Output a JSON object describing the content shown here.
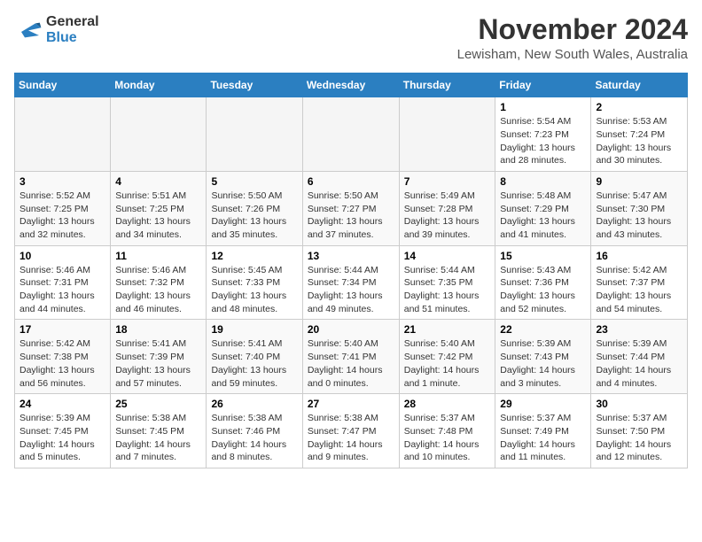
{
  "logo": {
    "line1": "General",
    "line2": "Blue"
  },
  "title": "November 2024",
  "subtitle": "Lewisham, New South Wales, Australia",
  "days_of_week": [
    "Sunday",
    "Monday",
    "Tuesday",
    "Wednesday",
    "Thursday",
    "Friday",
    "Saturday"
  ],
  "weeks": [
    [
      {
        "day": "",
        "info": ""
      },
      {
        "day": "",
        "info": ""
      },
      {
        "day": "",
        "info": ""
      },
      {
        "day": "",
        "info": ""
      },
      {
        "day": "",
        "info": ""
      },
      {
        "day": "1",
        "info": "Sunrise: 5:54 AM\nSunset: 7:23 PM\nDaylight: 13 hours\nand 28 minutes."
      },
      {
        "day": "2",
        "info": "Sunrise: 5:53 AM\nSunset: 7:24 PM\nDaylight: 13 hours\nand 30 minutes."
      }
    ],
    [
      {
        "day": "3",
        "info": "Sunrise: 5:52 AM\nSunset: 7:25 PM\nDaylight: 13 hours\nand 32 minutes."
      },
      {
        "day": "4",
        "info": "Sunrise: 5:51 AM\nSunset: 7:25 PM\nDaylight: 13 hours\nand 34 minutes."
      },
      {
        "day": "5",
        "info": "Sunrise: 5:50 AM\nSunset: 7:26 PM\nDaylight: 13 hours\nand 35 minutes."
      },
      {
        "day": "6",
        "info": "Sunrise: 5:50 AM\nSunset: 7:27 PM\nDaylight: 13 hours\nand 37 minutes."
      },
      {
        "day": "7",
        "info": "Sunrise: 5:49 AM\nSunset: 7:28 PM\nDaylight: 13 hours\nand 39 minutes."
      },
      {
        "day": "8",
        "info": "Sunrise: 5:48 AM\nSunset: 7:29 PM\nDaylight: 13 hours\nand 41 minutes."
      },
      {
        "day": "9",
        "info": "Sunrise: 5:47 AM\nSunset: 7:30 PM\nDaylight: 13 hours\nand 43 minutes."
      }
    ],
    [
      {
        "day": "10",
        "info": "Sunrise: 5:46 AM\nSunset: 7:31 PM\nDaylight: 13 hours\nand 44 minutes."
      },
      {
        "day": "11",
        "info": "Sunrise: 5:46 AM\nSunset: 7:32 PM\nDaylight: 13 hours\nand 46 minutes."
      },
      {
        "day": "12",
        "info": "Sunrise: 5:45 AM\nSunset: 7:33 PM\nDaylight: 13 hours\nand 48 minutes."
      },
      {
        "day": "13",
        "info": "Sunrise: 5:44 AM\nSunset: 7:34 PM\nDaylight: 13 hours\nand 49 minutes."
      },
      {
        "day": "14",
        "info": "Sunrise: 5:44 AM\nSunset: 7:35 PM\nDaylight: 13 hours\nand 51 minutes."
      },
      {
        "day": "15",
        "info": "Sunrise: 5:43 AM\nSunset: 7:36 PM\nDaylight: 13 hours\nand 52 minutes."
      },
      {
        "day": "16",
        "info": "Sunrise: 5:42 AM\nSunset: 7:37 PM\nDaylight: 13 hours\nand 54 minutes."
      }
    ],
    [
      {
        "day": "17",
        "info": "Sunrise: 5:42 AM\nSunset: 7:38 PM\nDaylight: 13 hours\nand 56 minutes."
      },
      {
        "day": "18",
        "info": "Sunrise: 5:41 AM\nSunset: 7:39 PM\nDaylight: 13 hours\nand 57 minutes."
      },
      {
        "day": "19",
        "info": "Sunrise: 5:41 AM\nSunset: 7:40 PM\nDaylight: 13 hours\nand 59 minutes."
      },
      {
        "day": "20",
        "info": "Sunrise: 5:40 AM\nSunset: 7:41 PM\nDaylight: 14 hours\nand 0 minutes."
      },
      {
        "day": "21",
        "info": "Sunrise: 5:40 AM\nSunset: 7:42 PM\nDaylight: 14 hours\nand 1 minute."
      },
      {
        "day": "22",
        "info": "Sunrise: 5:39 AM\nSunset: 7:43 PM\nDaylight: 14 hours\nand 3 minutes."
      },
      {
        "day": "23",
        "info": "Sunrise: 5:39 AM\nSunset: 7:44 PM\nDaylight: 14 hours\nand 4 minutes."
      }
    ],
    [
      {
        "day": "24",
        "info": "Sunrise: 5:39 AM\nSunset: 7:45 PM\nDaylight: 14 hours\nand 5 minutes."
      },
      {
        "day": "25",
        "info": "Sunrise: 5:38 AM\nSunset: 7:45 PM\nDaylight: 14 hours\nand 7 minutes."
      },
      {
        "day": "26",
        "info": "Sunrise: 5:38 AM\nSunset: 7:46 PM\nDaylight: 14 hours\nand 8 minutes."
      },
      {
        "day": "27",
        "info": "Sunrise: 5:38 AM\nSunset: 7:47 PM\nDaylight: 14 hours\nand 9 minutes."
      },
      {
        "day": "28",
        "info": "Sunrise: 5:37 AM\nSunset: 7:48 PM\nDaylight: 14 hours\nand 10 minutes."
      },
      {
        "day": "29",
        "info": "Sunrise: 5:37 AM\nSunset: 7:49 PM\nDaylight: 14 hours\nand 11 minutes."
      },
      {
        "day": "30",
        "info": "Sunrise: 5:37 AM\nSunset: 7:50 PM\nDaylight: 14 hours\nand 12 minutes."
      }
    ]
  ]
}
